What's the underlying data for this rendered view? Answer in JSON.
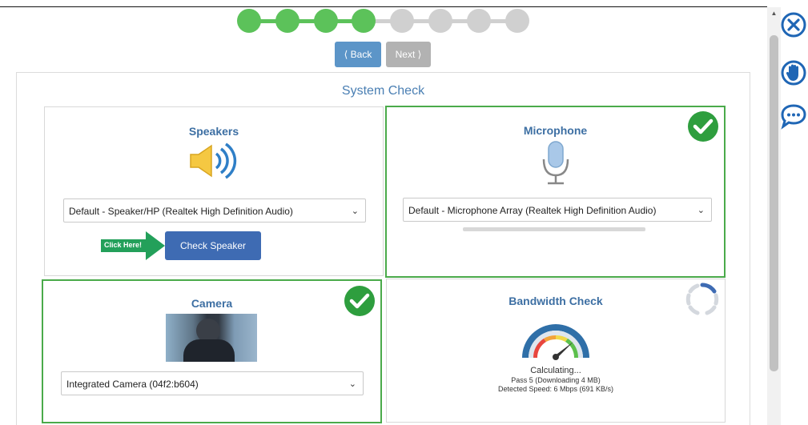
{
  "progress": {
    "total_steps": 8,
    "completed_steps": 4,
    "colors": {
      "done": "#5cc25a",
      "pending": "#d0d0d0"
    }
  },
  "nav": {
    "back_label": "⟨ Back",
    "next_label": "Next ⟩"
  },
  "panel": {
    "title": "System Check"
  },
  "speakers": {
    "title": "Speakers",
    "device": "Default - Speaker/HP (Realtek High Definition Audio)",
    "hint_label": "Click Here!",
    "check_button_label": "Check Speaker",
    "icon": "speaker-icon"
  },
  "microphone": {
    "title": "Microphone",
    "device": "Default - Microphone Array (Realtek High Definition Audio)",
    "status": "ok",
    "input_level": 0,
    "icon": "microphone-icon"
  },
  "camera": {
    "title": "Camera",
    "device": "Integrated Camera (04f2:b604)",
    "status": "ok"
  },
  "bandwidth": {
    "title": "Bandwidth Check",
    "status_text": "Calculating...",
    "pass_text": "Pass 5 (Downloading 4 MB)",
    "speed_text": "Detected Speed: 6 Mbps (691 KB/s)",
    "icon": "speedometer-icon"
  },
  "tools": [
    "close-circle-icon",
    "raise-hand-icon",
    "chat-icon"
  ],
  "colors": {
    "accent": "#3e6bb3",
    "title": "#3d6fa3",
    "success": "#4aaa4a",
    "hint": "#23a05a"
  }
}
